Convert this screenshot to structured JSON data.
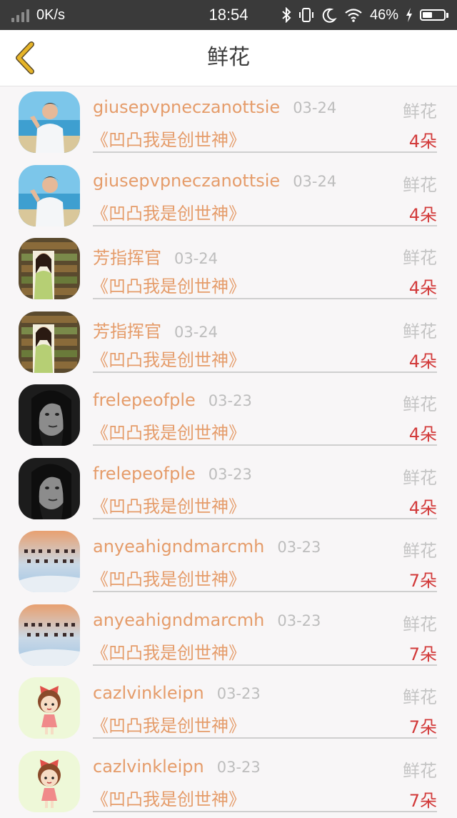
{
  "status_bar": {
    "network_speed": "0K/s",
    "time": "18:54",
    "battery_percent": "46%",
    "battery_level": 0.46,
    "icons": [
      "signal-icon",
      "bluetooth-icon",
      "vibrate-icon",
      "moon-icon",
      "wifi-icon",
      "charging-icon",
      "battery-icon"
    ]
  },
  "nav": {
    "back_icon": "chevron-left-icon",
    "title": "鲜花"
  },
  "colors": {
    "accent": "#e59c6a",
    "count": "#d23a3a",
    "muted": "#bdbdbd",
    "back_icon": "#e6b428"
  },
  "items": [
    {
      "name": "giusepvpneczanottsie",
      "date": "03-24",
      "gift": "鲜花",
      "book": "《凹凸我是创世神》",
      "count": "4朵",
      "avatar": "beach-man"
    },
    {
      "name": "giusepvpneczanottsie",
      "date": "03-24",
      "gift": "鲜花",
      "book": "《凹凸我是创世神》",
      "count": "4朵",
      "avatar": "beach-man"
    },
    {
      "name": "芳指挥官",
      "date": "03-24",
      "gift": "鲜花",
      "book": "《凹凸我是创世神》",
      "count": "4朵",
      "avatar": "library-girl"
    },
    {
      "name": "芳指挥官",
      "date": "03-24",
      "gift": "鲜花",
      "book": "《凹凸我是创世神》",
      "count": "4朵",
      "avatar": "library-girl"
    },
    {
      "name": "frelepeofple",
      "date": "03-23",
      "gift": "鲜花",
      "book": "《凹凸我是创世神》",
      "count": "4朵",
      "avatar": "bw-portrait"
    },
    {
      "name": "frelepeofple",
      "date": "03-23",
      "gift": "鲜花",
      "book": "《凹凸我是创世神》",
      "count": "4朵",
      "avatar": "bw-portrait"
    },
    {
      "name": "anyeahigndmarcmh",
      "date": "03-23",
      "gift": "鲜花",
      "book": "《凹凸我是创世神》",
      "count": "7朵",
      "avatar": "sky-calligraphy"
    },
    {
      "name": "anyeahigndmarcmh",
      "date": "03-23",
      "gift": "鲜花",
      "book": "《凹凸我是创世神》",
      "count": "7朵",
      "avatar": "sky-calligraphy"
    },
    {
      "name": "cazlvinkleipn",
      "date": "03-23",
      "gift": "鲜花",
      "book": "《凹凸我是创世神》",
      "count": "7朵",
      "avatar": "cartoon-girl"
    },
    {
      "name": "cazlvinkleipn",
      "date": "03-23",
      "gift": "鲜花",
      "book": "《凹凸我是创世神》",
      "count": "7朵",
      "avatar": "cartoon-girl"
    }
  ]
}
